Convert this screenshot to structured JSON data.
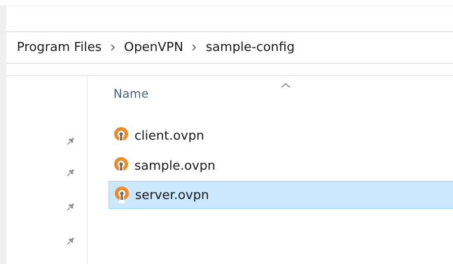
{
  "breadcrumb": {
    "segments": [
      "Program Files",
      "OpenVPN",
      "sample-config"
    ]
  },
  "file_list": {
    "column_header": "Name",
    "sort_direction": "ascending",
    "files": [
      {
        "name": "client.ovpn",
        "selected": false
      },
      {
        "name": "sample.ovpn",
        "selected": false
      },
      {
        "name": "server.ovpn",
        "selected": true
      }
    ]
  },
  "nav_pane": {
    "pinned_item_count": 4,
    "pin_icon": "pin-icon"
  },
  "colors": {
    "selection_background": "#cce8ff",
    "selection_border": "#99d1ff",
    "openvpn_icon_orange": "#f08a24",
    "header_text": "#4c607a"
  }
}
